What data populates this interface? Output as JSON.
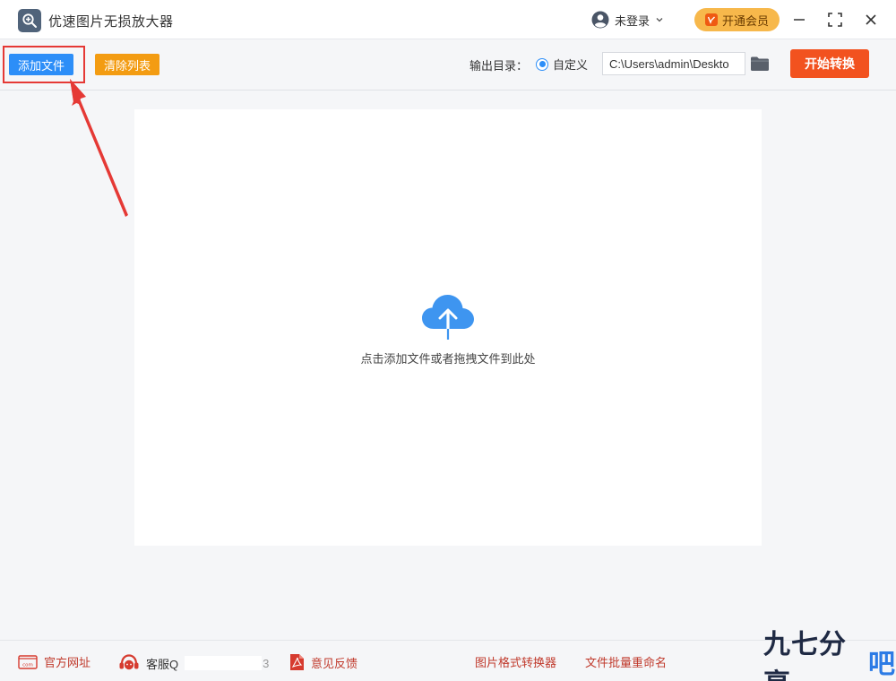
{
  "titlebar": {
    "app_title": "优速图片无损放大器",
    "user_label": "未登录",
    "vip_label": "开通会员"
  },
  "toolbar": {
    "add_files_label": "添加文件",
    "clear_list_label": "清除列表",
    "output_dir_label": "输出目录：",
    "custom_option_label": "自定义",
    "output_path_value": "C:\\Users\\admin\\Deskto",
    "start_label": "开始转换"
  },
  "dropzone": {
    "hint": "点击添加文件或者拖拽文件到此处"
  },
  "footer": {
    "website_label": "官方网址",
    "support_label": "客服Q",
    "support_tail": "3",
    "feedback_label": "意见反馈",
    "converter_label": "图片格式转换器",
    "rename_label": "文件批量重命名"
  },
  "watermark": {
    "main": "九七分享",
    "accent": "吧"
  },
  "colors": {
    "primary_blue": "#2c8ef8",
    "orange": "#f39c12",
    "start_red": "#f2521f",
    "highlight_red": "#e53935"
  }
}
